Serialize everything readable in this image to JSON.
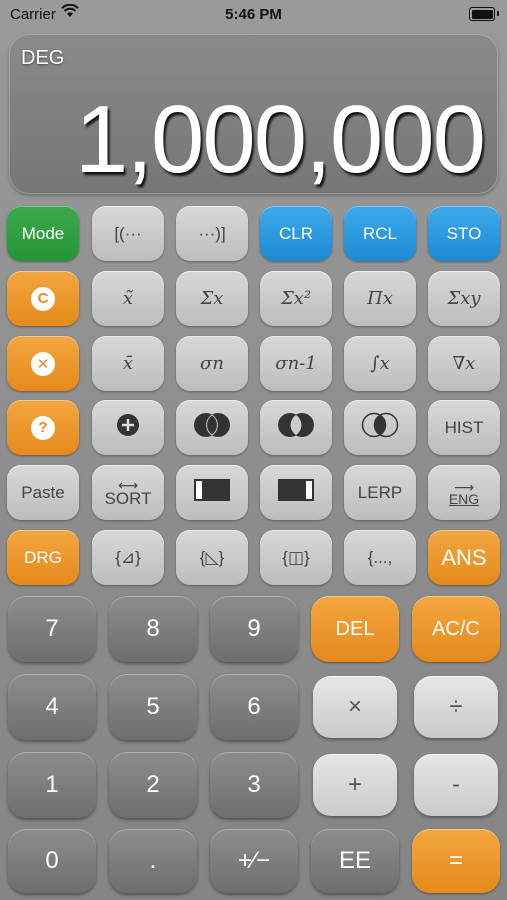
{
  "status_bar": {
    "carrier": "Carrier",
    "time": "5:46 PM",
    "battery_level": 1.0
  },
  "display": {
    "mode": "DEG",
    "value": "1,000,000"
  },
  "rows": {
    "r1": [
      "Mode",
      "[(···",
      "···)]",
      "CLR",
      "RCL",
      "STO"
    ],
    "r2": [
      "C",
      "x̃",
      "Σx",
      "Σx²",
      "Πx",
      "Σxy"
    ],
    "r3": [
      "x",
      "x̄",
      "σn",
      "σn-1",
      "∫x",
      "∇x"
    ],
    "r4": [
      "?",
      "",
      "",
      "",
      "",
      "HIST"
    ],
    "r5": [
      "Paste",
      "SORT",
      "",
      "",
      "LERP",
      "ENG"
    ],
    "r6": [
      "DRG",
      "{⊿}",
      "{◺}",
      "{◫}",
      "{...,",
      "ANS"
    ],
    "k1": [
      "7",
      "8",
      "9",
      "DEL",
      "AC/C"
    ],
    "k2": [
      "4",
      "5",
      "6",
      "×",
      "÷"
    ],
    "k3": [
      "1",
      "2",
      "3",
      "+",
      "-"
    ],
    "k4": [
      "0",
      ".",
      "+∕−",
      "EE",
      "="
    ]
  },
  "colors": {
    "green": "#249634",
    "blue": "#1e8ad4",
    "orange": "#e58a1c"
  },
  "icons": {
    "r2_0": "clear-circle-icon",
    "r3_0": "cancel-circle-icon",
    "r4_0": "help-circle-icon",
    "r4_1": "add-circle-icon",
    "r4_2": "venn-union-icon",
    "r4_3": "venn-difference-icon",
    "r4_4": "venn-intersection-icon",
    "r5_2": "rect-left-icon",
    "r5_3": "rect-right-icon"
  }
}
